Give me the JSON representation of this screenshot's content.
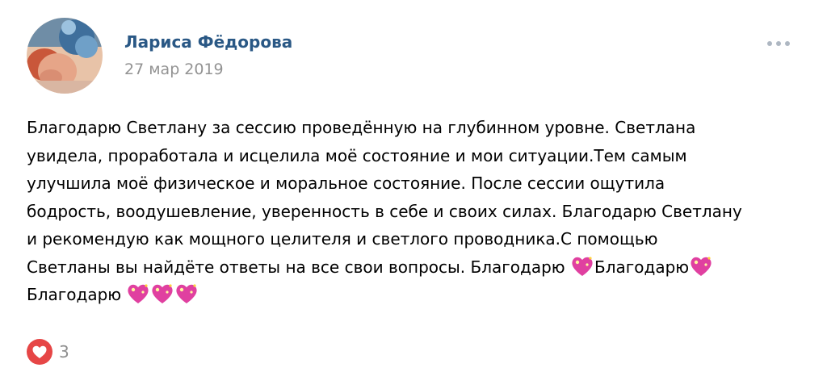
{
  "post": {
    "author": {
      "name": "Лариса Фёдорова"
    },
    "date": "27 мар 2019",
    "text_lines": [
      "Благодарю Светлану за сессию проведённую на глубинном уровне. Светлана",
      "увидела, проработала и исцелила моё состояние и мои ситуации.Тем самым",
      "улучшила моё физическое и моральное состояние. После сессии ощутила",
      "бодрость, воодушевление, уверенность в себе и своих силах. Благодарю Светлану",
      "и рекомендую как мощного целителя и светлого проводника.С помощью",
      "Светланы вы найдёте ответы на все свои вопросы. Благодарю",
      "Благодарю",
      "Благодарю"
    ],
    "likes": {
      "count": "3",
      "icon": "heart-icon"
    },
    "menu_icon": "more-dots-icon"
  },
  "colors": {
    "author_name": "#2a5885",
    "date": "#939393",
    "text": "#000000",
    "like_active": "#e64646",
    "like_count": "#8e8e8e",
    "emoji_heart": "#e040a0"
  }
}
